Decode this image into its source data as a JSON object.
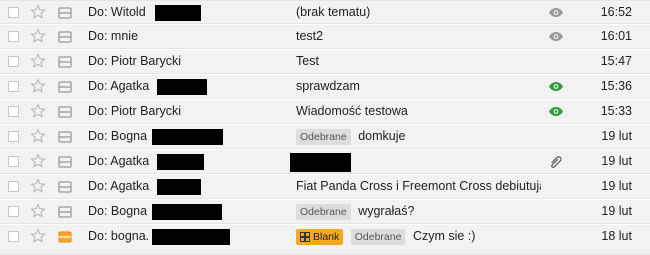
{
  "rows": [
    {
      "to": "Do: Witold",
      "subject": "(brak tematu)",
      "time": "16:52",
      "indicator": "eye-grey"
    },
    {
      "to": "Do: mnie",
      "subject": "test2",
      "time": "16:01",
      "indicator": "eye-grey"
    },
    {
      "to": "Do: Piotr Barycki",
      "subject": "Test",
      "time": "15:47",
      "indicator": "none"
    },
    {
      "to": "Do: Agatka",
      "subject": "sprawdzam",
      "time": "15:36",
      "indicator": "eye-green"
    },
    {
      "to": "Do: Piotr Barycki",
      "subject": "Wiadomość testowa",
      "time": "15:33",
      "indicator": "eye-green"
    },
    {
      "to": "Do: Bogna",
      "label1": "Odebrane",
      "subject": "domkuje",
      "time": "19 lut",
      "indicator": "none"
    },
    {
      "to": "Do: Agatka",
      "subject": "",
      "time": "19 lut",
      "indicator": "attachment"
    },
    {
      "to": "Do: Agatka",
      "subject": "Fiat Panda Cross i Freemont Cross debiutują",
      "time": "19 lut",
      "indicator": "none"
    },
    {
      "to": "Do: Bogna",
      "label1": "Odebrane",
      "subject": "wygrałaś?",
      "time": "19 lut",
      "indicator": "none"
    },
    {
      "to": "Do: bogna.",
      "label0": "Blank",
      "label1": "Odebrane",
      "subject": "Czym sie :)",
      "time": "18 lut",
      "indicator": "none"
    }
  ],
  "colors": {
    "row_bg": "#f2f2f2",
    "border": "#e5e5e5",
    "eye_grey": "#9a9a9a",
    "eye_green": "#2e9b3a",
    "label_grey": "#dddddd",
    "label_orange": "#f6a823",
    "importance_orange": "#f6a823"
  },
  "icons": [
    "checkbox",
    "star-icon",
    "importance-icon",
    "eye-icon",
    "paperclip-icon",
    "grid-icon"
  ]
}
